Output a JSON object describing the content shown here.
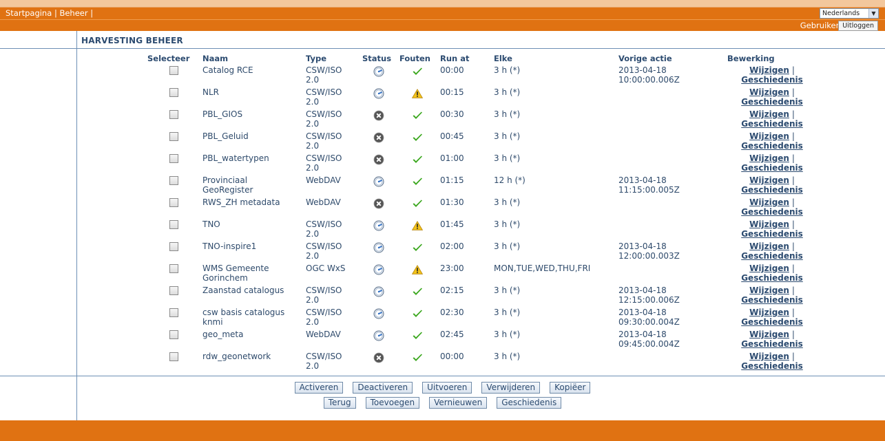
{
  "nav": {
    "home": "Startpagina",
    "sep1": "|",
    "admin": "Beheer",
    "sep2": "|"
  },
  "language": {
    "selected": "Nederlands",
    "arrow_icon": "chevron-down-icon"
  },
  "user": {
    "label": "Gebruiker:",
    "logout": "Uitloggen"
  },
  "page": {
    "title": "HARVESTING BEHEER"
  },
  "table": {
    "headers": {
      "select": "Selecteer",
      "name": "Naam",
      "type": "Type",
      "status": "Status",
      "errors": "Fouten",
      "run_at": "Run at",
      "every": "Elke",
      "last_action": "Vorige actie",
      "edit": "Bewerking"
    },
    "edit_link": "Wijzigen",
    "history_link": "Geschiedenis",
    "link_sep": "|",
    "rows": [
      {
        "name": "Catalog RCE",
        "type": "CSW/ISO 2.0",
        "status": "running",
        "errors": "ok",
        "run_at": "00:00",
        "every": "3 h (*)",
        "last": "2013-04-18 10:00:00.006Z"
      },
      {
        "name": "NLR",
        "type": "CSW/ISO 2.0",
        "status": "running",
        "errors": "warning",
        "run_at": "00:15",
        "every": "3 h (*)",
        "last": ""
      },
      {
        "name": "PBL_GIOS",
        "type": "CSW/ISO 2.0",
        "status": "stopped",
        "errors": "ok",
        "run_at": "00:30",
        "every": "3 h (*)",
        "last": ""
      },
      {
        "name": "PBL_Geluid",
        "type": "CSW/ISO 2.0",
        "status": "stopped",
        "errors": "ok",
        "run_at": "00:45",
        "every": "3 h (*)",
        "last": ""
      },
      {
        "name": "PBL_watertypen",
        "type": "CSW/ISO 2.0",
        "status": "stopped",
        "errors": "ok",
        "run_at": "01:00",
        "every": "3 h (*)",
        "last": ""
      },
      {
        "name": "Provinciaal GeoRegister",
        "type": "WebDAV",
        "status": "running",
        "errors": "ok",
        "run_at": "01:15",
        "every": "12 h (*)",
        "last": "2013-04-18 11:15:00.005Z"
      },
      {
        "name": "RWS_ZH metadata",
        "type": "WebDAV",
        "status": "stopped",
        "errors": "ok",
        "run_at": "01:30",
        "every": "3 h (*)",
        "last": ""
      },
      {
        "name": "TNO",
        "type": "CSW/ISO 2.0",
        "status": "running",
        "errors": "warning",
        "run_at": "01:45",
        "every": "3 h (*)",
        "last": ""
      },
      {
        "name": "TNO-inspire1",
        "type": "CSW/ISO 2.0",
        "status": "running",
        "errors": "ok",
        "run_at": "02:00",
        "every": "3 h (*)",
        "last": "2013-04-18 12:00:00.003Z"
      },
      {
        "name": "WMS Gemeente Gorinchem",
        "type": "OGC WxS",
        "status": "running",
        "errors": "warning",
        "run_at": "23:00",
        "every": "MON,TUE,WED,THU,FRI",
        "last": ""
      },
      {
        "name": "Zaanstad catalogus",
        "type": "CSW/ISO 2.0",
        "status": "running",
        "errors": "ok",
        "run_at": "02:15",
        "every": "3 h (*)",
        "last": "2013-04-18 12:15:00.006Z"
      },
      {
        "name": "csw basis catalogus knmi",
        "type": "CSW/ISO 2.0",
        "status": "running",
        "errors": "ok",
        "run_at": "02:30",
        "every": "3 h (*)",
        "last": "2013-04-18 09:30:00.004Z"
      },
      {
        "name": "geo_meta",
        "type": "WebDAV",
        "status": "running",
        "errors": "ok",
        "run_at": "02:45",
        "every": "3 h (*)",
        "last": "2013-04-18 09:45:00.004Z"
      },
      {
        "name": "rdw_geonetwork",
        "type": "CSW/ISO 2.0",
        "status": "stopped",
        "errors": "ok",
        "run_at": "00:00",
        "every": "3 h (*)",
        "last": ""
      }
    ]
  },
  "actions": {
    "activate": "Activeren",
    "deactivate": "Deactiveren",
    "run": "Uitvoeren",
    "delete": "Verwijderen",
    "copy": "Kopiëer",
    "back": "Terug",
    "add": "Toevoegen",
    "refresh": "Vernieuwen",
    "history": "Geschiedenis"
  },
  "colors": {
    "accent": "#e07212",
    "text": "#2c4b70",
    "ok": "#3ca81f",
    "stopped": "#555555",
    "warning": "#f2c21b",
    "running": "#3b7fd1"
  }
}
